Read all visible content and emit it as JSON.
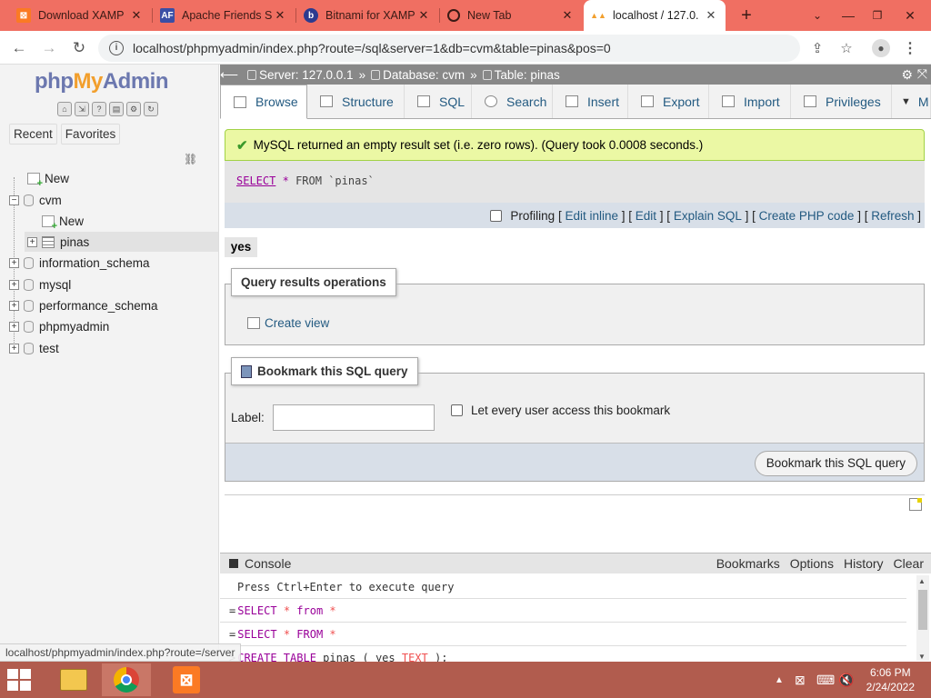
{
  "browser": {
    "tabs": [
      {
        "title": "Download XAMP",
        "icon": "xampp-icon"
      },
      {
        "title": "Apache Friends S",
        "icon": "apache-friends-icon"
      },
      {
        "title": "Bitnami for XAMP",
        "icon": "bitnami-icon"
      },
      {
        "title": "New Tab",
        "icon": "chrome-icon"
      },
      {
        "title": "localhost / 127.0.",
        "icon": "phpmyadmin-icon",
        "active": true
      }
    ],
    "url": "localhost/phpmyadmin/index.php?route=/sql&server=1&db=cvm&table=pinas&pos=0"
  },
  "sidebar": {
    "logo": {
      "php": "php",
      "my": "My",
      "admin": "Admin"
    },
    "tabs": [
      "Recent",
      "Favorites"
    ],
    "tree": [
      {
        "label": "New"
      },
      {
        "label": "cvm"
      },
      {
        "label": "New"
      },
      {
        "label": "pinas"
      },
      {
        "label": "information_schema"
      },
      {
        "label": "mysql"
      },
      {
        "label": "performance_schema"
      },
      {
        "label": "phpmyadmin"
      },
      {
        "label": "test"
      }
    ]
  },
  "breadcrumb": {
    "server": "Server: 127.0.0.1",
    "database": "Database: cvm",
    "table": "Table: pinas",
    "sep": "»"
  },
  "toptabs": [
    "Browse",
    "Structure",
    "SQL",
    "Search",
    "Insert",
    "Export",
    "Import",
    "Privileges",
    "M"
  ],
  "result": {
    "message": "MySQL returned an empty result set (i.e. zero rows). (Query took 0.0008 seconds.)",
    "sql_kw1": "SELECT",
    "sql_rest": "FROM",
    "sql_star": "*",
    "sql_table": "`pinas`"
  },
  "profiling": {
    "label": "Profiling",
    "links": [
      "Edit inline",
      "Edit",
      "Explain SQL",
      "Create PHP code",
      "Refresh"
    ]
  },
  "column": "yes",
  "query_ops": {
    "legend": "Query results operations",
    "create_view": "Create view"
  },
  "bookmark": {
    "legend": "Bookmark this SQL query",
    "label": "Label:",
    "checkbox": "Let every user access this bookmark",
    "button": "Bookmark this SQL query"
  },
  "console": {
    "title": "Console",
    "links": [
      "Bookmarks",
      "Options",
      "History",
      "Clear"
    ],
    "hint": "Press Ctrl+Enter to execute query",
    "lines": [
      {
        "prefix": "=",
        "kw": "SELECT",
        "mid": " * ",
        "kw2": "from",
        "rest": " *"
      },
      {
        "prefix": "=",
        "kw": "SELECT",
        "mid": " * ",
        "kw2": "FROM",
        "rest": " *"
      },
      {
        "prefix": ">",
        "kw": "CREATE TABLE",
        "mid": " pinas ( yes ",
        "kw2": "TEXT",
        "rest": " );"
      }
    ]
  },
  "status_url": "localhost/phpmyadmin/index.php?route=/server",
  "taskbar": {
    "time": "6:06 PM",
    "date": "2/24/2022"
  },
  "colors": {
    "accent": "#f06f62",
    "link": "#235a81",
    "success_bg": "#ebf8a4"
  }
}
